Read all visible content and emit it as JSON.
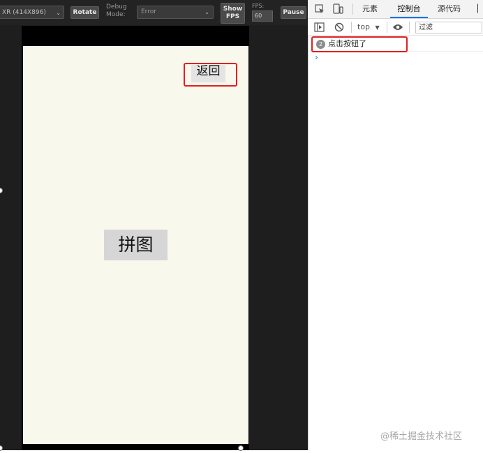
{
  "simulator": {
    "device_select": "XR (414X896)",
    "rotate": "Rotate",
    "debug_label": "Debug Mode:",
    "debug_value": "Error",
    "show_fps": "Show FPS",
    "fps_label": "FPS:",
    "fps_value": "60",
    "pause": "Pause"
  },
  "game": {
    "back_button": "返回",
    "puzzle_button": "拼图",
    "background_color": "#f9f8ed"
  },
  "devtools": {
    "tabs": [
      "元素",
      "控制台",
      "源代码"
    ],
    "active_tab": "控制台",
    "context": "top",
    "filter_placeholder": "过滤",
    "log": {
      "count": "2",
      "message": "点击按钮了"
    },
    "prompt": "›",
    "accent": "#1a73e8"
  },
  "highlight_color": "#e02020",
  "watermark": "@稀土掘金技术社区"
}
